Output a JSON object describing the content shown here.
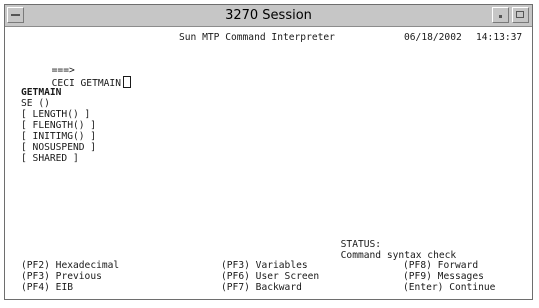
{
  "window": {
    "title": "3270 Session"
  },
  "header": {
    "app_title": "Sun MTP Command Interpreter",
    "date": "06/18/2002",
    "time": "14:13:37"
  },
  "command": {
    "prompt": "===>",
    "text": "CECI GETMAIN"
  },
  "body": {
    "heading": "GETMAIN",
    "options": [
      "SE ()",
      "[ LENGTH() ]",
      "[ FLENGTH() ]",
      "[ INITIMG() ]",
      "[ NOSUSPEND ]",
      "[ SHARED ]"
    ]
  },
  "status": {
    "label": "STATUS:",
    "message": "Command syntax check"
  },
  "function_keys": [
    {
      "key": "(PF2)",
      "label": "Hexadecimal"
    },
    {
      "key": "(PF3)",
      "label": "Variables"
    },
    {
      "key": "(PF8)",
      "label": "Forward"
    },
    {
      "key": "(PF3)",
      "label": "Previous"
    },
    {
      "key": "(PF6)",
      "label": "User Screen"
    },
    {
      "key": "(PF9)",
      "label": "Messages"
    },
    {
      "key": "(PF4)",
      "label": "EIB"
    },
    {
      "key": "(PF7)",
      "label": "Backward"
    },
    {
      "key": "(Enter)",
      "label": "Continue"
    }
  ]
}
